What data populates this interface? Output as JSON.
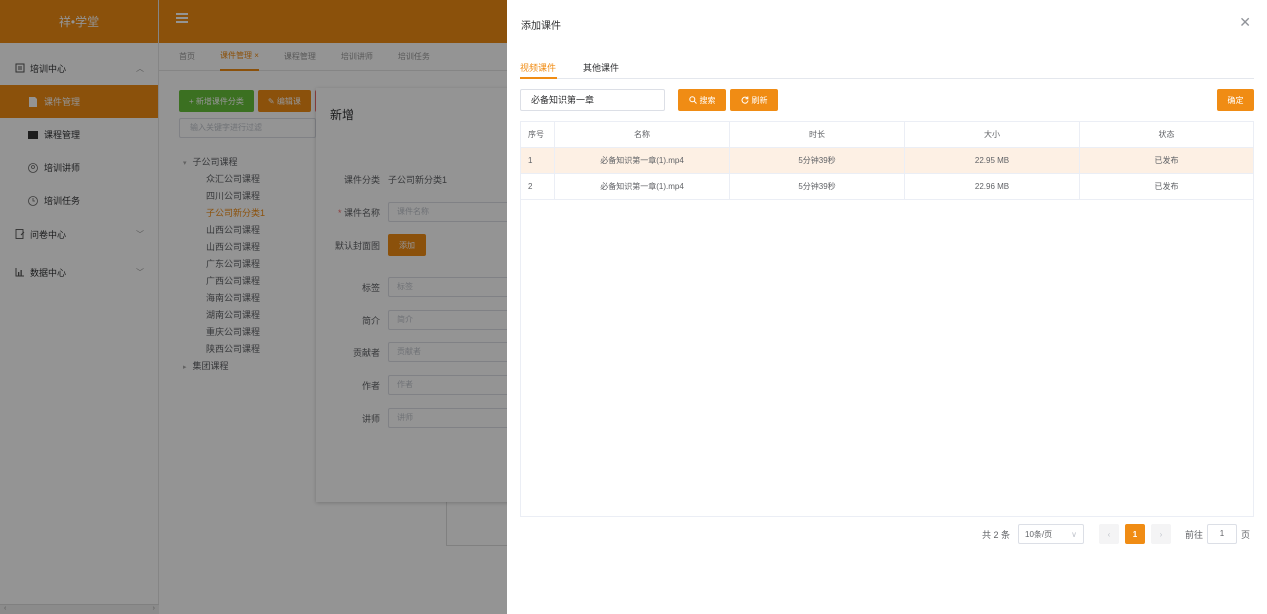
{
  "app": {
    "logo": "祥•学堂"
  },
  "sidebar": {
    "groups": [
      {
        "label": "培训中心"
      },
      {
        "label": "问卷中心"
      },
      {
        "label": "数据中心"
      }
    ],
    "items": [
      {
        "label": "课件管理"
      },
      {
        "label": "课程管理"
      },
      {
        "label": "培训讲师"
      },
      {
        "label": "培训任务"
      }
    ]
  },
  "tabs": [
    {
      "label": "首页"
    },
    {
      "label": "课件管理 ×"
    },
    {
      "label": "课程管理"
    },
    {
      "label": "培训讲师"
    },
    {
      "label": "培训任务"
    }
  ],
  "main": {
    "add_category_btn": "+ 新增课件分类",
    "edit_btn": "✎ 编辑课",
    "filter_placeholder": "输入关键字进行过滤",
    "tree": [
      {
        "label": "子公司课程",
        "level": 1
      },
      {
        "label": "众汇公司课程",
        "level": 2
      },
      {
        "label": "四川公司课程",
        "level": 2
      },
      {
        "label": "子公司新分类1",
        "level": 2
      },
      {
        "label": "山西公司课程",
        "level": 2
      },
      {
        "label": "山西公司课程",
        "level": 2
      },
      {
        "label": "广东公司课程",
        "level": 2
      },
      {
        "label": "广西公司课程",
        "level": 2
      },
      {
        "label": "海南公司课程",
        "level": 2
      },
      {
        "label": "湖南公司课程",
        "level": 2
      },
      {
        "label": "重庆公司课程",
        "level": 2
      },
      {
        "label": "陕西公司课程",
        "level": 2
      },
      {
        "label": "集团课程",
        "level": 1
      }
    ]
  },
  "dialog": {
    "title": "新增",
    "category_label": "课件分类",
    "category_value": "子公司新分类1",
    "name_label": "课件名称",
    "name_placeholder": "课件名称",
    "cover_label": "默认封面图",
    "cover_btn": "添加",
    "tag_label": "标签",
    "tag_placeholder": "标签",
    "intro_label": "简介",
    "intro_placeholder": "简介",
    "contributor_label": "贡献者",
    "contributor_placeholder": "贡献者",
    "author_label": "作者",
    "author_placeholder": "作者",
    "lecturer_label": "讲师",
    "lecturer_placeholder": "讲师"
  },
  "drawer": {
    "title": "添加课件",
    "tabs": [
      "视频课件",
      "其他课件"
    ],
    "search_value": "必备知识第一章",
    "search_btn": "搜索",
    "refresh_btn": "刷新",
    "confirm_btn": "确定",
    "table": {
      "headers": [
        "序号",
        "名称",
        "时长",
        "大小",
        "状态"
      ],
      "rows": [
        [
          "1",
          "必备知识第一章(1).mp4",
          "5分钟39秒",
          "22.95 MB",
          "已发布"
        ],
        [
          "2",
          "必备知识第一章(1).mp4",
          "5分钟39秒",
          "22.96 MB",
          "已发布"
        ]
      ]
    },
    "pager": {
      "total": "共 2 条",
      "page_size": "10条/页",
      "current": "1",
      "goto_label": "前往",
      "goto_value": "1",
      "page_unit": "页"
    }
  }
}
